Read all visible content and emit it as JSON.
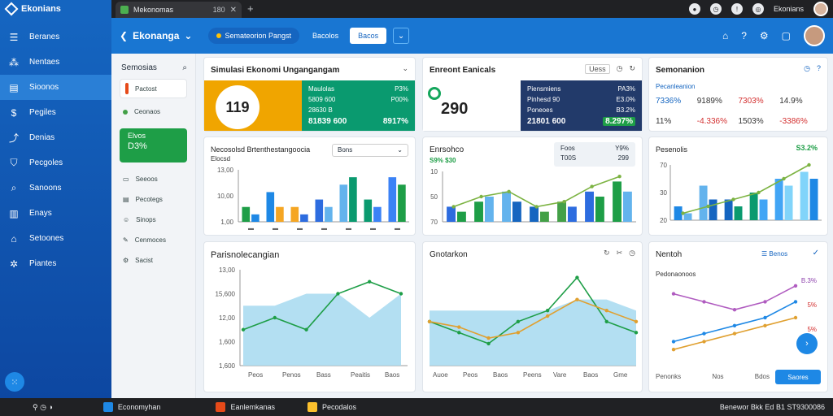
{
  "logo_text": "Ekonians",
  "browser_tab": {
    "title": "Mekonomas",
    "count": "180"
  },
  "topbar_right": {
    "user": "Ekonians"
  },
  "sidebar": {
    "items": [
      {
        "label": "Beranes",
        "icon": "menu-icon"
      },
      {
        "label": "Nentaes",
        "icon": "network-icon"
      },
      {
        "label": "Sioonos",
        "icon": "page-icon"
      },
      {
        "label": "Pegiles",
        "icon": "money-icon"
      },
      {
        "label": "Denias",
        "icon": "flow-icon"
      },
      {
        "label": "Pecgoles",
        "icon": "shield-icon"
      },
      {
        "label": "Sanoons",
        "icon": "search-icon"
      },
      {
        "label": "Enays",
        "icon": "chart-icon"
      },
      {
        "label": "Setoones",
        "icon": "bank-icon"
      },
      {
        "label": "Piantes",
        "icon": "cog-icon"
      }
    ]
  },
  "appbar": {
    "title": "Ekonanga",
    "pill": "Semateorion Pangst",
    "link": "Bacolos",
    "white_button": "Bacos"
  },
  "leftpanel": {
    "title": "Semosias",
    "items": [
      "Pactost",
      "Ceonaos"
    ],
    "green_card": {
      "line1": "Elvos",
      "line2": "D3%"
    },
    "list": [
      {
        "label": "Seeoos",
        "icon": "folder-icon"
      },
      {
        "label": "Pecotegs",
        "icon": "clipboard-icon"
      },
      {
        "label": "Sinops",
        "icon": "user-icon"
      },
      {
        "label": "Cenmoces",
        "icon": "pen-icon"
      },
      {
        "label": "Sacist",
        "icon": "gear-icon"
      }
    ]
  },
  "cards": {
    "c1": {
      "title": "Simulasi Ekonomi Ungangangam",
      "disk_value": "119",
      "rows": [
        [
          "Maulolas",
          "P3%"
        ],
        [
          "5809 600",
          "P00%"
        ],
        [
          "28630 B",
          ""
        ],
        [
          "81839 600",
          "8917%"
        ]
      ]
    },
    "c2": {
      "title": "Enreont Eanicals",
      "badge": "Uess",
      "big_value": "290",
      "rows": [
        [
          "Piensmiens",
          "PA3%"
        ],
        [
          "Pinhesd 90",
          "E3.0%"
        ],
        [
          "Poneoes",
          "B3.2%"
        ],
        [
          "21801 600",
          "8.297%"
        ]
      ]
    },
    "c3": {
      "title": "Semonanion",
      "subtitle": "Pecanleanion",
      "stats": [
        [
          "7336%",
          "blue"
        ],
        [
          "9189%",
          "dark"
        ],
        [
          "7303%",
          "red"
        ],
        [
          "11%",
          "dark"
        ],
        [
          "-4.336%",
          "red"
        ],
        [
          "1503%",
          "dark"
        ]
      ],
      "extra": "14.9%",
      "extra2": "-3386%"
    },
    "c4": {
      "title": "Necosolsd Brtenthestangoocia",
      "badge": "Elocsd",
      "select_value": "Bons",
      "yticks": [
        "13,00",
        "10,00",
        "1,00"
      ]
    },
    "c5": {
      "title": "Enrsohco",
      "legend": "S9% $30",
      "box1": "Foos",
      "box2": "Y9%",
      "box3": "T00S",
      "box4": "299",
      "yticks": [
        "10",
        "50",
        "70"
      ]
    },
    "c6": {
      "title": "Pesenolis",
      "value": "S3.2%",
      "yticks": [
        "70",
        "30",
        "20"
      ]
    },
    "c7": {
      "title": "Parisnolecangian",
      "yticks": [
        "13,00",
        "15,600",
        "12,00",
        "1,600",
        "1,600"
      ],
      "xticks": [
        "Peos",
        "Penos",
        "Bass",
        "Peaitis",
        "Baos"
      ]
    },
    "c8": {
      "title": "Gnotarkon",
      "xticks": [
        "Auoe",
        "Peos",
        "Baos",
        "Peens",
        "Vare",
        "Baos",
        "Gme"
      ]
    },
    "c9": {
      "title": "Nentoh",
      "badge": "Benos",
      "subtitle": "Pedonaonoos",
      "values": [
        "B.3%",
        "5%",
        "5%"
      ],
      "xticks": [
        "Penonks",
        "Nos",
        "Bdos"
      ],
      "button": "Saores"
    }
  },
  "chart_data": [
    {
      "type": "bar",
      "title": "Necosolsd Brtenthestangoocia",
      "series": [
        {
          "values": [
            2,
            4,
            2,
            3,
            5,
            3,
            6
          ]
        },
        {
          "values": [
            1,
            2,
            1,
            2,
            6,
            2,
            5
          ]
        }
      ]
    },
    {
      "type": "bar",
      "title": "Enrsohco",
      "series": [
        {
          "values": [
            3,
            4,
            6,
            3,
            4,
            6,
            8
          ]
        },
        {
          "values": [
            2,
            5,
            4,
            2,
            3,
            5,
            6
          ]
        }
      ],
      "line": [
        3,
        5,
        6,
        3,
        4,
        7,
        9
      ]
    },
    {
      "type": "bar",
      "title": "Pesenolis",
      "series": [
        {
          "values": [
            2,
            5,
            3,
            4,
            6,
            7
          ]
        },
        {
          "values": [
            1,
            3,
            2,
            3,
            5,
            6
          ]
        }
      ],
      "line": [
        1,
        2,
        3,
        4,
        6,
        8
      ]
    },
    {
      "type": "area",
      "title": "Parisnolecangian",
      "area": [
        5,
        5,
        6,
        6,
        4,
        6
      ],
      "line": [
        3,
        4,
        3,
        6,
        7,
        6
      ]
    },
    {
      "type": "area",
      "title": "Gnotarkon",
      "area": [
        5,
        5,
        5,
        5,
        5,
        6,
        6,
        5
      ],
      "line": [
        4,
        3,
        2,
        4,
        5,
        8,
        4,
        3
      ]
    },
    {
      "type": "line",
      "title": "Nentoh",
      "series": [
        {
          "values": [
            8,
            7,
            6,
            7,
            9
          ]
        },
        {
          "values": [
            2,
            3,
            4,
            5,
            7
          ]
        },
        {
          "values": [
            1,
            2,
            3,
            4,
            5
          ]
        }
      ]
    }
  ]
}
